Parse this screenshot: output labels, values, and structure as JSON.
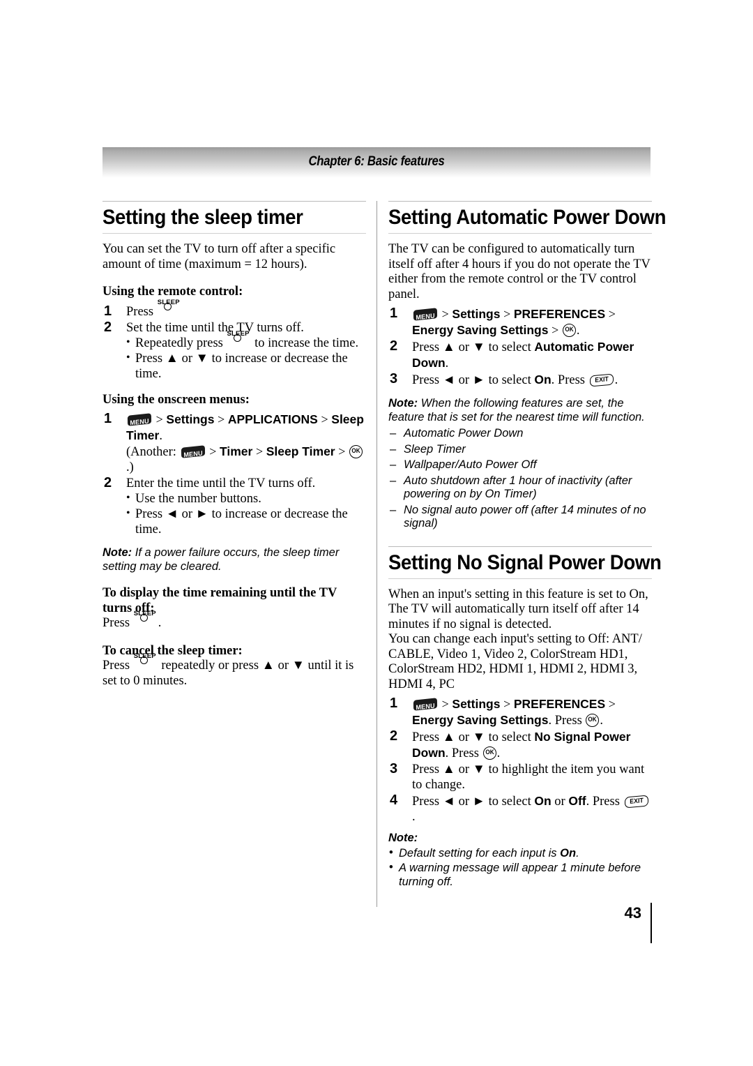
{
  "header": {
    "chapter_label": "Chapter 6: Basic features"
  },
  "footer": {
    "page_number": "43"
  },
  "icons": {
    "sleep_label": "SLEEP",
    "menu_label": "MENU",
    "ok_label": "OK",
    "exit_label": "EXIT"
  },
  "left_column": {
    "section1": {
      "heading": "Setting the sleep timer",
      "intro": "You can set the TV to turn off after a specific amount of time (maximum = 12 hours).",
      "subhead_remote": "Using the remote control:",
      "step1_prefix": "Press ",
      "step2_text": "Set the time until the TV turns off.",
      "step2_bullet1_a": "Repeatedly press ",
      "step2_bullet1_b": " to increase the time.",
      "step2_bullet2": "Press ▲ or ▼ to increase or decrease the time.",
      "subhead_onscreen": "Using the onscreen menus:",
      "menu_step1": {
        "gt1": ">",
        "settings": "Settings",
        "gt2": ">",
        "applications": "APPLICATIONS",
        "gt3": ">",
        "sleep_timer": "Sleep Timer",
        "period": ".",
        "another_open": "(Another: ",
        "another_gt1": ">",
        "timer": "Timer",
        "another_gt2": ">",
        "another_sleep_timer": "Sleep Timer",
        "another_gt3": ">",
        "another_close": ".)"
      },
      "step2_onscreen": "Enter the time until the TV turns off.",
      "onscreen_bullet1": "Use the number buttons.",
      "onscreen_bullet2": "Press ◄ or ► to increase or decrease the time.",
      "note_label": "Note:",
      "note_text": "If a power failure occurs, the sleep timer setting may be cleared.",
      "display_head": "To display the time remaining until the TV turns off:",
      "display_press": "Press ",
      "display_period": ".",
      "cancel_head": "To cancel the sleep timer:",
      "cancel_press": "Press ",
      "cancel_rest": " repeatedly or press ▲ or ▼ until it is set to 0 minutes."
    }
  },
  "right_column": {
    "section2": {
      "heading": "Setting Automatic Power Down",
      "intro": "The TV can be configured to automatically turn itself off after 4 hours if you do not operate the TV either from the remote control or the TV control panel.",
      "step1": {
        "gt1": ">",
        "settings": "Settings",
        "gt2": ">",
        "preferences": "PREFERENCES",
        "gt3": ">",
        "energy_saving": "Energy Saving Settings",
        "gt4": ">",
        "period": "."
      },
      "step2_pre": "Press ▲ or ▼ to select ",
      "step2_bold": "Automatic Power Down",
      "step2_post": ".",
      "step3_pre": "Press ◄ or ► to select ",
      "step3_bold": "On",
      "step3_mid": ". Press ",
      "step3_post": ".",
      "note_label": "Note:",
      "note_text": "When the following features are set, the feature that is set for the nearest time will function.",
      "dash_items": [
        "Automatic Power Down",
        "Sleep Timer",
        "Wallpaper/Auto Power Off",
        "Auto shutdown after 1 hour of inactivity (after powering on by On Timer)",
        "No signal auto power off (after 14 minutes of no signal)"
      ]
    },
    "section3": {
      "heading": "Setting No Signal Power Down",
      "intro_p1": "When an input's setting in this feature is set to On, The TV will automatically turn itself off after 14 minutes if no signal is detected.",
      "intro_p2": "You can change each input's setting to Off: ANT/ CABLE, Video 1, Video 2, ColorStream HD1, ColorStream HD2, HDMI 1, HDMI 2, HDMI 3, HDMI 4, PC",
      "step1": {
        "gt1": ">",
        "settings": "Settings",
        "gt2": ">",
        "preferences": "PREFERENCES",
        "gt3": ">",
        "energy_saving": "Energy Saving Settings",
        "press": ". Press ",
        "period": "."
      },
      "step2_pre": "Press ▲ or ▼ to select ",
      "step2_bold": "No Signal Power Down",
      "step2_mid": ". Press ",
      "step2_post": ".",
      "step3": "Press ▲ or ▼ to highlight the item you want to change.",
      "step4_pre": "Press ◄ or ► to select ",
      "step4_bold1": "On",
      "step4_or": " or ",
      "step4_bold2": "Off",
      "step4_mid": ". Press ",
      "step4_post": ".",
      "note_label": "Note:",
      "note_bullet1_pre": "Default setting for each input is ",
      "note_bullet1_bold": "On",
      "note_bullet1_post": ".",
      "note_bullet2": "A warning message will appear 1 minute before turning off."
    }
  }
}
